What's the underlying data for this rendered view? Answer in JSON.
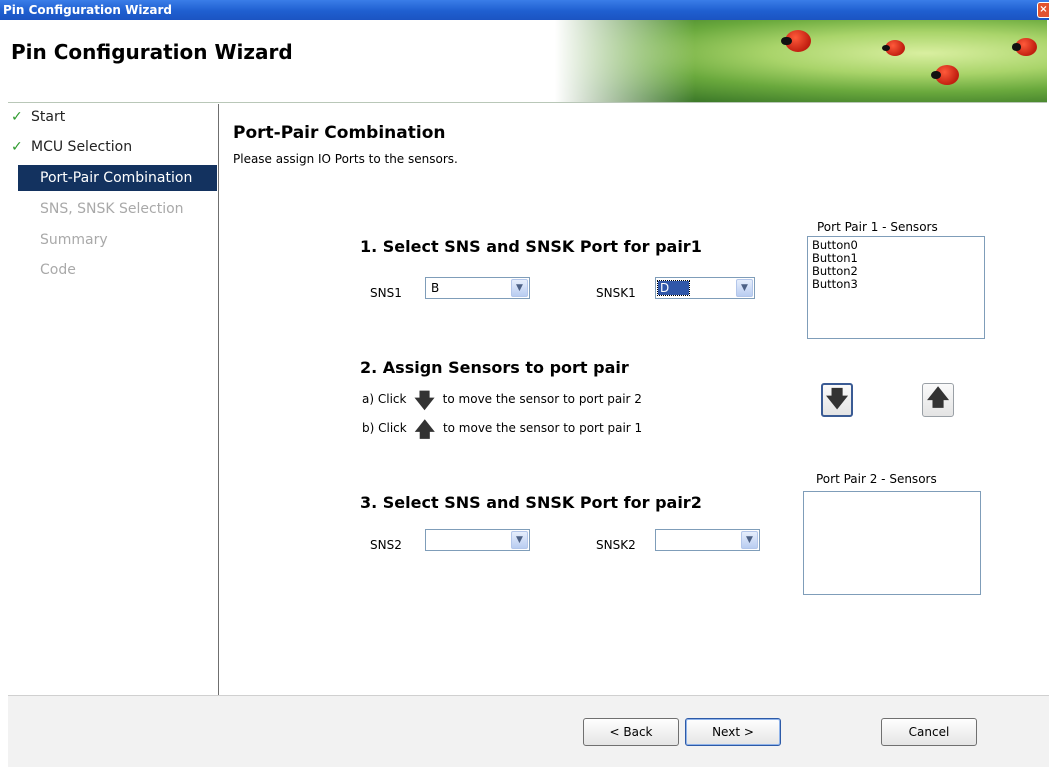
{
  "window": {
    "title": "Pin Configuration Wizard"
  },
  "header": {
    "title": "Pin Configuration Wizard"
  },
  "sidebar": {
    "items": [
      {
        "label": "Start",
        "state": "done"
      },
      {
        "label": "MCU Selection",
        "state": "done"
      },
      {
        "label": "Port-Pair Combination",
        "state": "current"
      },
      {
        "label": "SNS, SNSK Selection",
        "state": "disabled"
      },
      {
        "label": "Summary",
        "state": "disabled"
      },
      {
        "label": "Code",
        "state": "disabled"
      }
    ]
  },
  "main": {
    "title": "Port-Pair Combination",
    "subtitle": "Please assign IO Ports to the sensors.",
    "step1": {
      "heading": "1. Select SNS and SNSK Port for pair1",
      "sns_label": "SNS1",
      "sns_value": "B",
      "snsk_label": "SNSK1",
      "snsk_value": "D"
    },
    "step2": {
      "heading": "2. Assign Sensors to port pair",
      "hint_a_prefix": "a) Click",
      "hint_a_suffix": "to move the sensor to port pair 2",
      "hint_b_prefix": "b) Click",
      "hint_b_suffix": "to move the sensor to port pair 1"
    },
    "step3": {
      "heading": "3. Select SNS and SNSK Port for pair2",
      "sns_label": "SNS2",
      "sns_value": "",
      "snsk_label": "SNSK2",
      "snsk_value": ""
    },
    "pair1_list": {
      "caption": "Port Pair 1 - Sensors",
      "items": [
        "Button0",
        "Button1",
        "Button2",
        "Button3"
      ]
    },
    "pair2_list": {
      "caption": "Port Pair 2 - Sensors",
      "items": []
    },
    "move_down_icon": "arrow-down-icon",
    "move_up_icon": "arrow-up-icon"
  },
  "footer": {
    "back_label": "< Back",
    "next_label": "Next >",
    "cancel_label": "Cancel"
  },
  "colors": {
    "titlebar": "#1f5fd0",
    "nav_current_bg": "#13325f",
    "check": "#2e9b2e",
    "disabled_text": "#a9a9a9"
  }
}
